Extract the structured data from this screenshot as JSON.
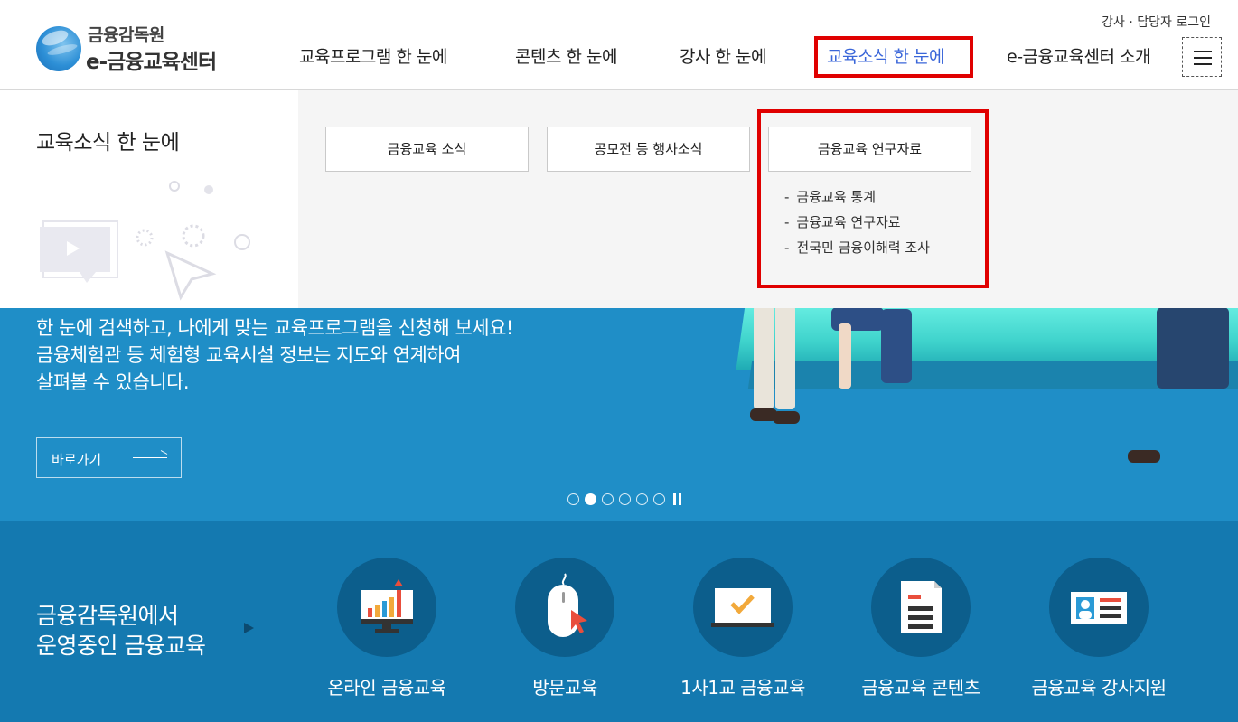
{
  "logo": {
    "top": "금융감독원",
    "bottom": "e-금융교육센터"
  },
  "util": {
    "instructor": "강사",
    "separator": "·",
    "manager_login": "담당자 로그인"
  },
  "gnb": {
    "items": [
      {
        "label": "교육프로그램 한 눈에"
      },
      {
        "label": "콘텐츠 한 눈에"
      },
      {
        "label": "강사 한 눈에"
      },
      {
        "label": "교육소식 한 눈에",
        "active": true
      },
      {
        "label": "e-금융교육센터 소개"
      }
    ]
  },
  "dropdown": {
    "title": "교육소식 한 눈에",
    "buttons": [
      {
        "label": "금융교육 소식"
      },
      {
        "label": "공모전 등 행사소식"
      },
      {
        "label": "금융교육 연구자료"
      }
    ],
    "sub_items": [
      {
        "label": "금융교육 통계"
      },
      {
        "label": "금융교육 연구자료"
      },
      {
        "label": "전국민 금융이해력 조사"
      }
    ]
  },
  "hero": {
    "lines": [
      "한 눈에 검색하고, 나에게 맞는 교육프로그램을 신청해 보세요!",
      "금융체험관 등 체험형 교육시설 정보는 지도와 연계하여",
      "살펴볼 수 있습니다."
    ],
    "button_label": "바로가기",
    "slides_count": 6,
    "active_slide": 2
  },
  "bottom": {
    "title_line1": "금융감독원에서",
    "title_line2": "운영중인 금융교육",
    "services": [
      {
        "label": "온라인 금융교육",
        "icon": "monitor-chart-icon"
      },
      {
        "label": "방문교육",
        "icon": "mouse-icon"
      },
      {
        "label": "1사1교 금융교육",
        "icon": "board-check-icon"
      },
      {
        "label": "금융교육 콘텐츠",
        "icon": "document-icon"
      },
      {
        "label": "금융교육 강사지원",
        "icon": "id-card-icon"
      }
    ]
  },
  "colors": {
    "accent_blue": "#3a66d9",
    "highlight_red": "#e00000",
    "hero_bg": "#1f8ec7",
    "bottom_bg": "#1479b0",
    "circle_bg": "#0c5e8c"
  }
}
